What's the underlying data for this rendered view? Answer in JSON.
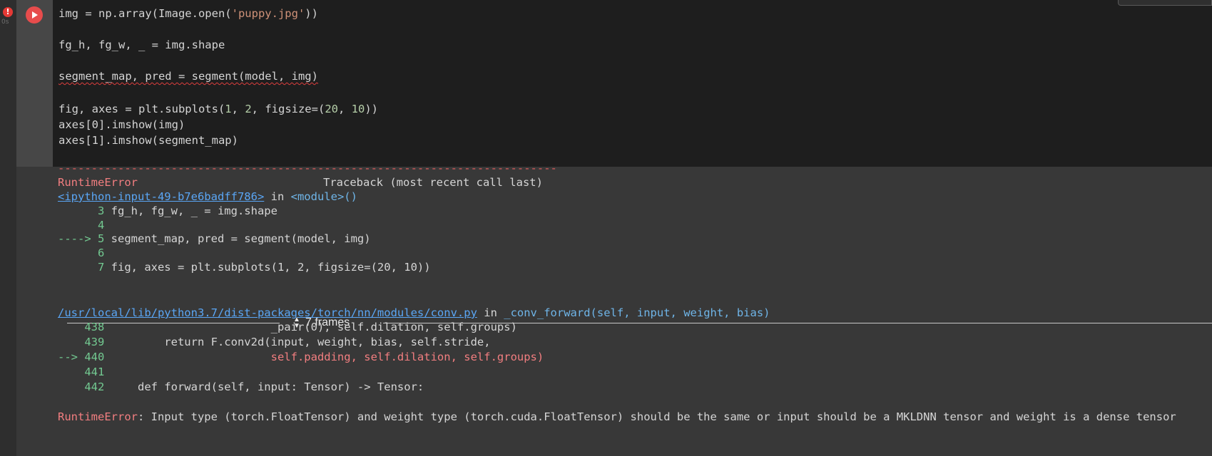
{
  "cell": {
    "status_icon": "!",
    "exec_time": "0s",
    "run_button": "play-icon",
    "code_lines": [
      {
        "pre": "img = np.array(Image.open(",
        "str": "'puppy.jpg'",
        "post": "))"
      },
      {
        "text": "fg_h, fg_w, _ = img.shape"
      },
      {
        "text": "segment_map, pred = segment(model, img)"
      },
      {
        "pre": "fig, axes = plt.subplots(",
        "n1": "1",
        "m1": ", ",
        "n2": "2",
        "m2": ", figsize=(",
        "n3": "20",
        "m3": ", ",
        "n4": "10",
        "post": "))"
      },
      {
        "text": "axes[0].imshow(img)"
      },
      {
        "text": "axes[1].imshow(segment_map)"
      }
    ]
  },
  "traceback": {
    "separator": "---------------------------------------------------------------------------",
    "error_name": "RuntimeError",
    "header_right": "Traceback (most recent call last)",
    "frame1": {
      "link": "<ipython-input-49-b7e6badff786>",
      "in_text": " in ",
      "location": "<module>()",
      "lines": [
        {
          "num": "      3 ",
          "code": "fg_h, fg_w, _ = img.shape"
        },
        {
          "num": "      4 ",
          "code": ""
        },
        {
          "num": "----> 5 ",
          "code": "segment_map, pred = segment(model, img)"
        },
        {
          "num": "      6 ",
          "code": ""
        },
        {
          "num": "      7 ",
          "code": "fig, axes = plt.subplots(1, 2, figsize=(20, 10))"
        }
      ]
    },
    "frames_toggle": "7 frames",
    "frame2": {
      "link": "/usr/local/lib/python3.7/dist-packages/torch/nn/modules/conv.py",
      "in_text": " in ",
      "location": "_conv_forward(self, input, weight, bias)",
      "lines": [
        {
          "num": "    438 ",
          "code": "                        _pair(0), self.dilation, self.groups)"
        },
        {
          "num": "    439 ",
          "code": "        return F.conv2d(input, weight, bias, self.stride,"
        },
        {
          "num": "--> 440 ",
          "code": "                        self.padding, self.dilation, self.groups)"
        },
        {
          "num": "    441 ",
          "code": ""
        },
        {
          "num": "    442 ",
          "code": "    def forward(self, input: Tensor) -> Tensor:"
        }
      ]
    },
    "final_error": {
      "name": "RuntimeError",
      "message": ": Input type (torch.FloatTensor) and weight type (torch.cuda.FloatTensor) should be the same or input should be a MKLDNN tensor and weight is a dense tensor"
    }
  }
}
